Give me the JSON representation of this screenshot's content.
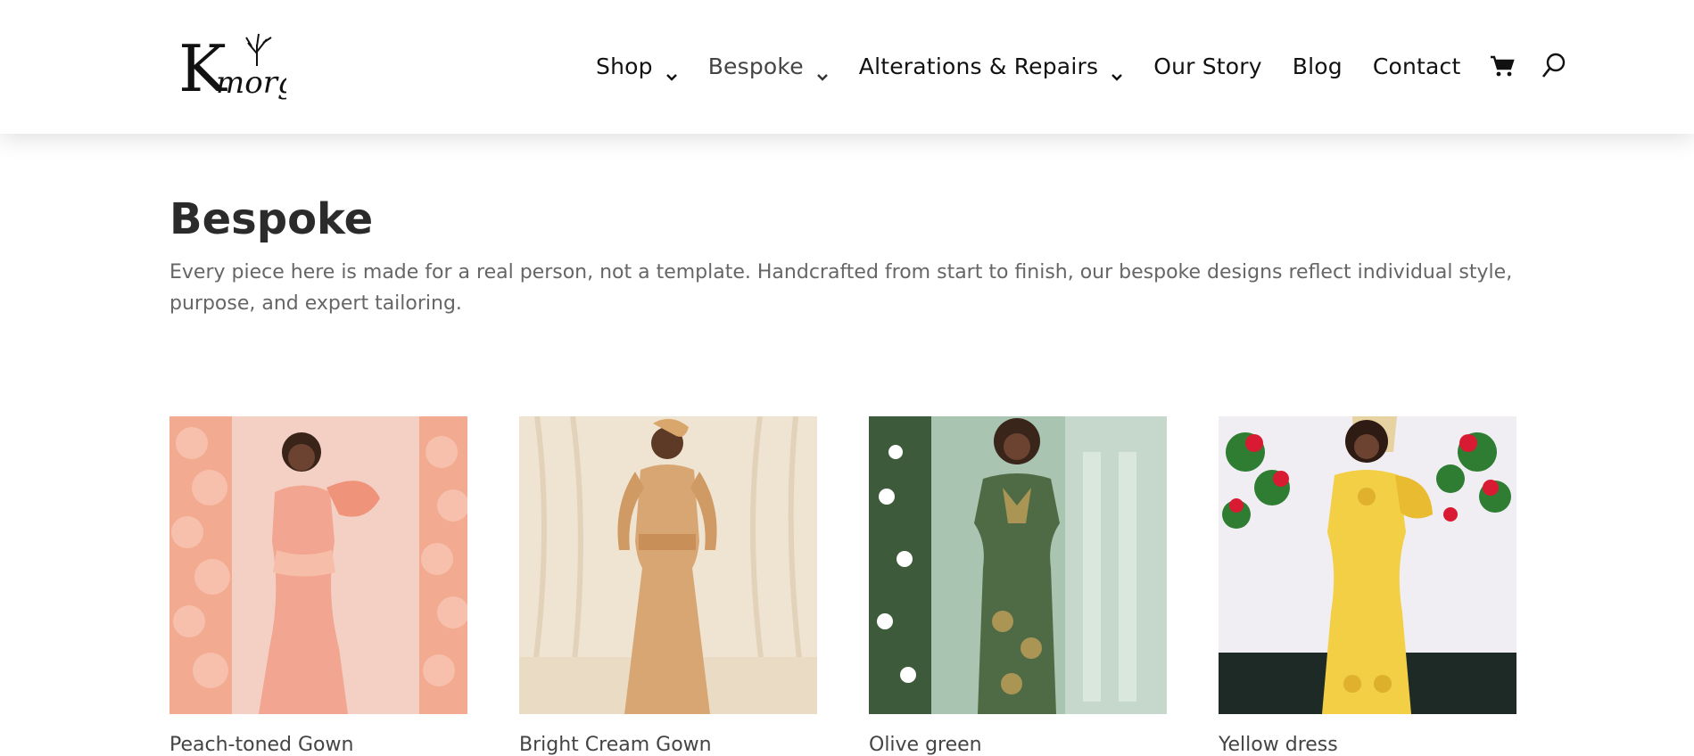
{
  "header": {
    "logo_text": "Kmorg",
    "nav": [
      {
        "label": "Shop",
        "has_dropdown": true
      },
      {
        "label": "Bespoke",
        "has_dropdown": true,
        "active": true
      },
      {
        "label": "Alterations & Repairs",
        "has_dropdown": true
      },
      {
        "label": "Our Story",
        "has_dropdown": false
      },
      {
        "label": "Blog",
        "has_dropdown": false
      },
      {
        "label": "Contact",
        "has_dropdown": false
      }
    ],
    "icons": [
      "cart-icon",
      "search-icon"
    ]
  },
  "main": {
    "title": "Bespoke",
    "description": "Every piece here is made for a real person, not a template. Handcrafted from start to finish, our bespoke designs reflect individual style, purpose, and expert tailoring."
  },
  "products": [
    {
      "name": "Peach-toned Gown",
      "bg_color": "#f3c9bc",
      "dress_color": "#f0a58f"
    },
    {
      "name": "Bright Cream Gown",
      "bg_color": "#efe2cf",
      "dress_color": "#d7a772"
    },
    {
      "name": "Olive green",
      "bg_color": "#8fae98",
      "dress_color": "#4f6b45"
    },
    {
      "name": "Yellow dress",
      "bg_color": "#f0eef2",
      "dress_color": "#f2cf45"
    }
  ],
  "colors": {
    "title": "#2b2b2b",
    "text": "#666666",
    "nav_text": "#111111"
  }
}
